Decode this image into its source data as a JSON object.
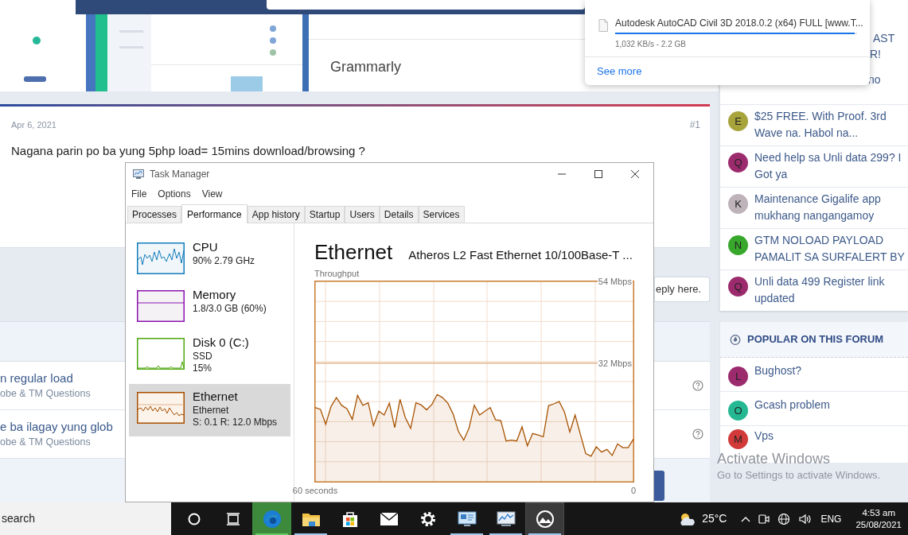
{
  "web_page": {
    "ad_title": "Grammarly",
    "post": {
      "date": "Apr 6, 2021",
      "number": "#1",
      "text": "Nagana parin po ba yung 5php load= 15mins download/browsing ?"
    },
    "reply_field": "eply here.",
    "threads": [
      {
        "title": "n regular load",
        "forum": "obe & TM Questions"
      },
      {
        "title": "e ba ilagay yung glob",
        "forum": "obe & TM Questions"
      }
    ],
    "sidebar": {
      "partial_texts": [
        "AST",
        "R!",
        "no"
      ],
      "latest": [
        {
          "letter": "E",
          "color": "#a8a43c",
          "title": "$25 FREE. With Proof. 3rd Wave na. Habol na..."
        },
        {
          "letter": "Q",
          "color": "#9c2b6e",
          "title": "Need help sa Unli data 299? I Got ya"
        },
        {
          "letter": "K",
          "color": "#bdb3b9",
          "title": "Maintenance Gigalife app mukhang nangangamoy"
        },
        {
          "letter": "N",
          "color": "#38a82c",
          "title": "GTM NOLOAD PAYLOAD PAMALIT SA SURFALERT BY"
        },
        {
          "letter": "Q",
          "color": "#9c2b6e",
          "title": "Unli data 499 Register link updated"
        }
      ],
      "popular": {
        "heading": "POPULAR ON THIS FORUM",
        "items": [
          {
            "letter": "L",
            "color": "#9c2b6e",
            "title": "Bughost?"
          },
          {
            "letter": "O",
            "color": "#25b893",
            "title": "Gcash problem"
          },
          {
            "letter": "M",
            "color": "#d23a3a",
            "title": "Vps"
          }
        ]
      }
    }
  },
  "downloads": {
    "file": "Autodesk AutoCAD Civil 3D 2018.0.2 (x64) FULL [www.T...",
    "level": 0.99,
    "status": "1,032 KB/s - 2.2 GB",
    "see_more": "See more"
  },
  "task_manager": {
    "title": "Task Manager",
    "menu": [
      "File",
      "Options",
      "View"
    ],
    "tabs": [
      {
        "label": "Processes",
        "selected": false
      },
      {
        "label": "Performance",
        "selected": true
      },
      {
        "label": "App history",
        "selected": false
      },
      {
        "label": "Startup",
        "selected": false
      },
      {
        "label": "Users",
        "selected": false
      },
      {
        "label": "Details",
        "selected": false
      },
      {
        "label": "Services",
        "selected": false
      }
    ],
    "resources": [
      {
        "kind": "cpu",
        "name": "CPU",
        "details": [
          "90% 2.79 GHz"
        ],
        "selected": false
      },
      {
        "kind": "memory",
        "name": "Memory",
        "details": [
          "1.8/3.0 GB (60%)"
        ],
        "selected": false
      },
      {
        "kind": "disk",
        "name": "Disk 0 (C:)",
        "details": [
          "SSD",
          "15%"
        ],
        "selected": false
      },
      {
        "kind": "ethernet",
        "name": "Ethernet",
        "details": [
          "Ethernet",
          "S: 0.1 R: 12.0 Mbps"
        ],
        "selected": true
      }
    ],
    "detail": {
      "heading": "Ethernet",
      "adapter": "Atheros L2 Fast Ethernet 10/100Base-T ...",
      "chart_data": {
        "type": "area",
        "title": "Throughput",
        "ylim": [
          0,
          54
        ],
        "ref_lines": [
          {
            "axis": "y",
            "value": 32
          }
        ],
        "categories": [
          "60 seconds",
          null,
          null,
          null,
          null,
          null,
          null,
          null,
          null,
          null,
          null,
          null,
          null,
          null,
          null,
          null,
          null,
          null,
          null,
          null,
          null,
          null,
          null,
          null,
          null,
          null,
          null,
          null,
          null,
          null,
          null,
          null,
          null,
          null,
          null,
          null,
          null,
          null,
          null,
          null,
          null,
          null,
          null,
          null,
          null,
          null,
          null,
          null,
          null,
          null,
          null,
          null,
          null,
          null,
          null,
          null,
          null,
          null,
          null,
          null,
          "0"
        ],
        "yticks": [
          {
            "value": 54,
            "label": "54 Mbps"
          },
          {
            "value": 32,
            "label": "32 Mbps"
          }
        ],
        "series": [
          {
            "color": "#a75200",
            "values": [
              20,
              19.5,
              15.5,
              20.3,
              22.7,
              20.6,
              19.7,
              16.8,
              23.3,
              20.6,
              21.3,
              15.1,
              19,
              18,
              21.2,
              14.6,
              22.2,
              17.3,
              14.4,
              21.3,
              20.7,
              19.4,
              20.8,
              23.5,
              22.7,
              21.2,
              18.3,
              13.6,
              11.2,
              14.4,
              20.6,
              18,
              19,
              20,
              16.7,
              16.5,
              11,
              11.2,
              11,
              14.8,
              9.7,
              13,
              12.6,
              12.1,
              20.5,
              21,
              21.6,
              18.8,
              13.4,
              18,
              12.8,
              7.6,
              6.9,
              9.4,
              8,
              8.7,
              7.1,
              10.2,
              9.2,
              9.2,
              11.5
            ]
          }
        ]
      }
    }
  },
  "os_notice": {
    "title": "Activate Windows",
    "subtitle": "Go to Settings to activate Windows."
  },
  "taskbar": {
    "search_text": "search",
    "apps": [
      {
        "kind": "cortana",
        "running": false,
        "flashing": false,
        "selected": false
      },
      {
        "kind": "task_view",
        "running": false,
        "flashing": false,
        "selected": false
      },
      {
        "kind": "edge",
        "running": true,
        "flashing": true,
        "selected": false
      },
      {
        "kind": "explorer",
        "running": true,
        "flashing": false,
        "selected": false
      },
      {
        "kind": "store",
        "running": false,
        "flashing": false,
        "selected": false
      },
      {
        "kind": "mail",
        "running": false,
        "flashing": false,
        "selected": false
      },
      {
        "kind": "settings",
        "running": false,
        "flashing": false,
        "selected": false
      },
      {
        "kind": "monitor",
        "running": true,
        "flashing": false,
        "selected": false
      },
      {
        "kind": "task_manager",
        "running": true,
        "flashing": false,
        "selected": false
      },
      {
        "kind": "photos",
        "running": true,
        "flashing": false,
        "selected": true
      }
    ],
    "weather": "25°C",
    "language": "ENG",
    "time": "4:53 am",
    "date": "25/08/2021"
  }
}
